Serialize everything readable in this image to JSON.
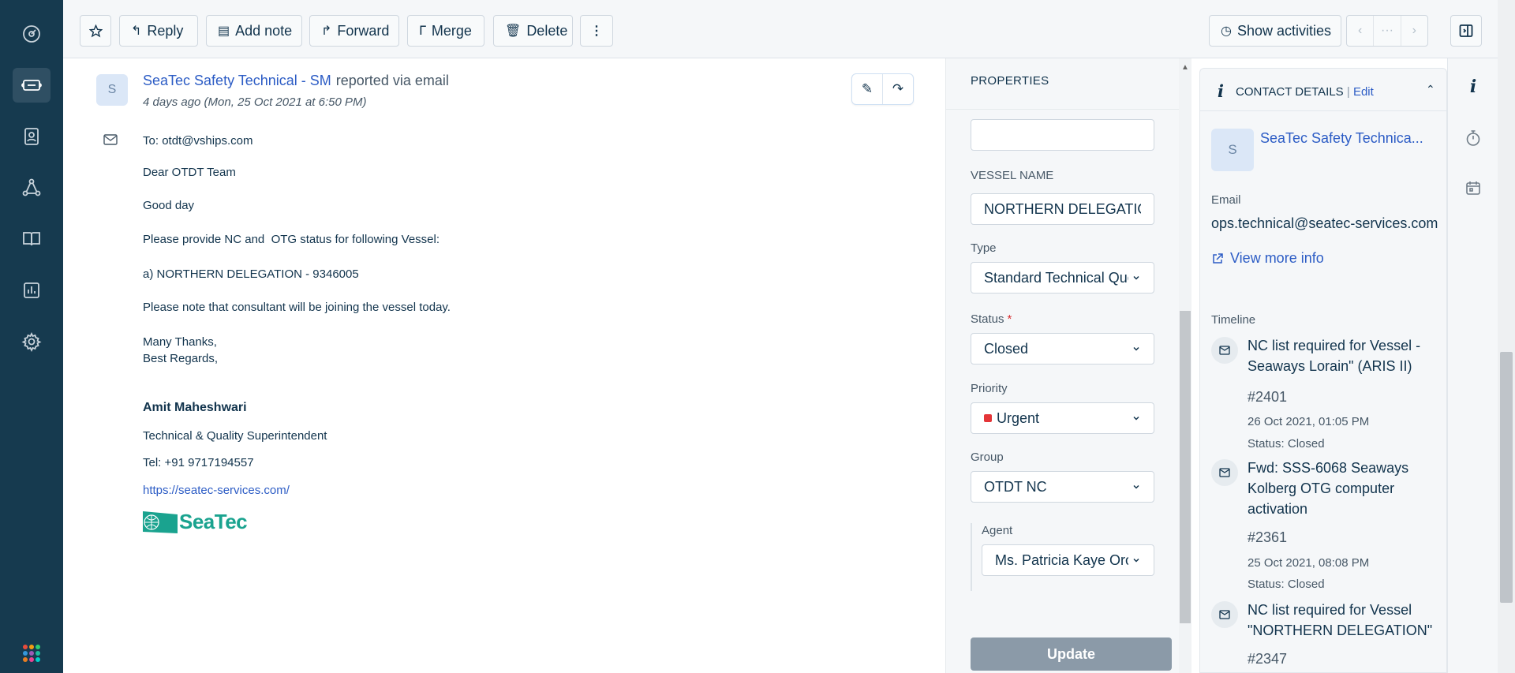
{
  "toolbar": {
    "reply": "Reply",
    "add_note": "Add note",
    "forward": "Forward",
    "merge": "Merge",
    "delete": "Delete",
    "show_activities": "Show activities",
    "nav_middle": "···"
  },
  "conversation": {
    "avatar_initial": "S",
    "sender_name": "SeaTec Safety Technical - SM",
    "reported_via": "reported via email",
    "timestamp": "4 days ago (Mon, 25 Oct 2021 at 6:50 PM)",
    "to_label": "To:",
    "to_address": "otdt@vships.com",
    "body": {
      "greeting": "Dear OTDT Team",
      "opening": "Good day",
      "request": "Please provide NC and  OTG status for following Vessel:",
      "vessel": "a) NORTHERN DELEGATION - 9346005",
      "note": "Please note that consultant will be joining the vessel today.",
      "thanks": "Many Thanks,",
      "regards": "Best Regards,"
    },
    "signature": {
      "name": "Amit Maheshwari",
      "role": "Technical & Quality Superintendent",
      "phone": "Tel: +91 9717194557",
      "website": "https://seatec-services.com/",
      "logo_text": "SeaTec"
    }
  },
  "properties": {
    "title": "PROPERTIES",
    "top_field_value": "",
    "vessel_name_label": "VESSEL NAME",
    "vessel_name_value": "NORTHERN DELEGATION",
    "type_label": "Type",
    "type_value": "Standard Technical Que",
    "status_label": "Status",
    "status_required": "*",
    "status_value": "Closed",
    "priority_label": "Priority",
    "priority_value": "Urgent",
    "group_label": "Group",
    "group_value": "OTDT NC",
    "agent_label": "Agent",
    "agent_value": "Ms. Patricia Kaye Oro",
    "update_button": "Update"
  },
  "contact": {
    "header_title": "CONTACT DETAILS",
    "header_sep": "|",
    "edit": "Edit",
    "avatar_initial": "S",
    "name": "SeaTec Safety Technica...",
    "email_label": "Email",
    "email_value": "ops.technical@seatec-services.com",
    "view_more": "View more info",
    "timeline_label": "Timeline",
    "timeline": [
      {
        "title": "NC list required for Vessel - Seaways Lorain\" (ARIS II)",
        "number": "#2401",
        "date": "26 Oct 2021, 01:05 PM",
        "status": "Status: Closed"
      },
      {
        "title": "Fwd: SSS-6068 Seaways Kolberg OTG computer activation",
        "number": "#2361",
        "date": "25 Oct 2021, 08:08 PM",
        "status": "Status: Closed"
      },
      {
        "title": "NC list required for Vessel \"NORTHERN DELEGATION\"",
        "number": "#2347",
        "date": "",
        "status": ""
      }
    ]
  },
  "colors": {
    "nav_bg": "#163a4f",
    "link": "#2c5cc5",
    "urgent": "#e43538",
    "update_button": "#8b9aa8",
    "logo": "#1aa38f"
  }
}
